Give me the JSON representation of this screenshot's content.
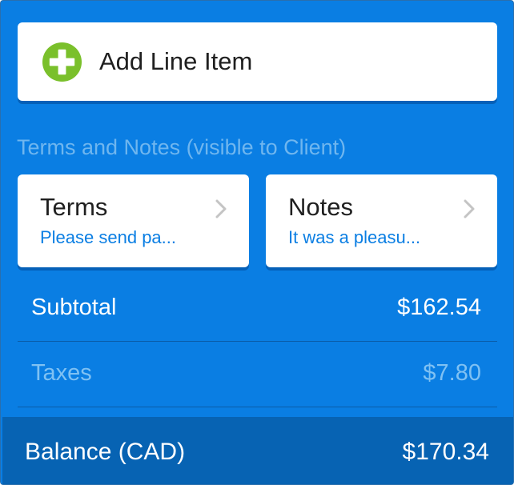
{
  "add_line_item": {
    "label": "Add Line Item",
    "icon": "plus-circle-icon",
    "icon_color": "#7ac02b"
  },
  "terms_notes": {
    "section_title": "Terms and Notes (visible to Client)",
    "terms": {
      "title": "Terms",
      "preview": "Please send pa..."
    },
    "notes": {
      "title": "Notes",
      "preview": "It was a pleasu..."
    }
  },
  "summary": {
    "subtotal": {
      "label": "Subtotal",
      "value": "$162.54"
    },
    "taxes": {
      "label": "Taxes",
      "value": "$7.80"
    },
    "balance": {
      "label": "Balance (CAD)",
      "value": "$170.34"
    }
  },
  "colors": {
    "background": "#0a7ee3",
    "balance_bar": "#0763b3",
    "accent_green": "#7ac02b",
    "link_blue": "#0a7ee3"
  }
}
